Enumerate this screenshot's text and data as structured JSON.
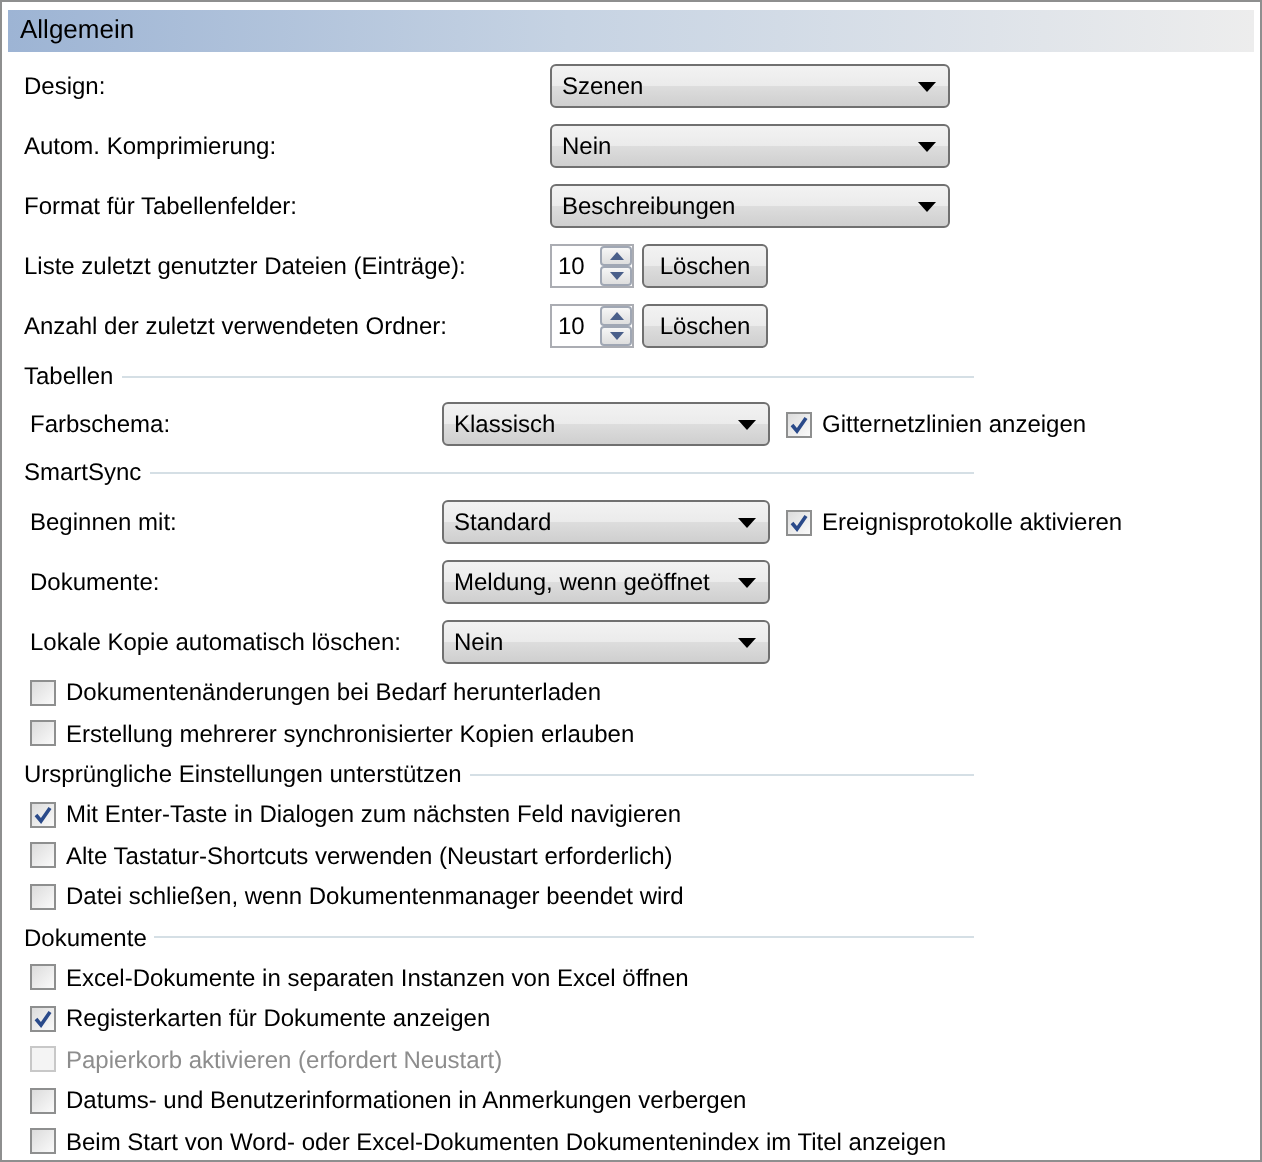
{
  "header": {
    "title": "Allgemein"
  },
  "general": [
    {
      "kind": "dropdown",
      "label": "Design:",
      "value": "Szenen"
    },
    {
      "kind": "dropdown",
      "label": "Autom. Komprimierung:",
      "value": "Nein"
    },
    {
      "kind": "dropdown",
      "label": "Format für Tabellenfelder:",
      "value": "Beschreibungen"
    },
    {
      "kind": "spinner",
      "label": "Liste zuletzt genutzter Dateien (Einträge):",
      "value": "10",
      "button": "Löschen"
    },
    {
      "kind": "spinner",
      "label": "Anzahl der zuletzt verwendeten Ordner:",
      "value": "10",
      "button": "Löschen"
    }
  ],
  "sections": [
    {
      "title": "Tabellen",
      "rows": [
        {
          "kind": "dropdown",
          "label": "Farbschema:",
          "value": "Klassisch",
          "checkbox": {
            "label": "Gitternetzlinien anzeigen",
            "checked": true
          }
        }
      ]
    },
    {
      "title": "SmartSync",
      "rows": [
        {
          "kind": "dropdown",
          "label": "Beginnen mit:",
          "value": "Standard",
          "checkbox": {
            "label": "Ereignisprotokolle aktivieren",
            "checked": true
          }
        },
        {
          "kind": "dropdown",
          "label": "Dokumente:",
          "value": "Meldung, wenn geöffnet"
        },
        {
          "kind": "dropdown",
          "label": "Lokale Kopie automatisch löschen:",
          "value": "Nein"
        },
        {
          "kind": "checkbox",
          "label": "Dokumentenänderungen bei Bedarf herunterladen",
          "checked": false,
          "disabled": false
        },
        {
          "kind": "checkbox",
          "label": "Erstellung mehrerer synchronisierter Kopien erlauben",
          "checked": false,
          "disabled": false
        }
      ]
    },
    {
      "title": "Ursprüngliche Einstellungen unterstützen",
      "rows": [
        {
          "kind": "checkbox",
          "label": "Mit Enter-Taste in Dialogen zum nächsten Feld navigieren",
          "checked": true,
          "disabled": false
        },
        {
          "kind": "checkbox",
          "label": "Alte Tastatur-Shortcuts verwenden (Neustart erforderlich)",
          "checked": false,
          "disabled": false
        },
        {
          "kind": "checkbox",
          "label": "Datei schließen, wenn Dokumentenmanager beendet wird",
          "checked": false,
          "disabled": false
        }
      ]
    },
    {
      "title": "Dokumente",
      "rows": [
        {
          "kind": "checkbox",
          "label": "Excel-Dokumente in separaten Instanzen von Excel öffnen",
          "checked": false,
          "disabled": false
        },
        {
          "kind": "checkbox",
          "label": "Registerkarten für Dokumente anzeigen",
          "checked": true,
          "disabled": false
        },
        {
          "kind": "checkbox",
          "label": "Papierkorb aktivieren (erfordert Neustart)",
          "checked": false,
          "disabled": true
        },
        {
          "kind": "checkbox",
          "label": "Datums- und Benutzerinformationen in Anmerkungen verbergen",
          "checked": false,
          "disabled": false
        },
        {
          "kind": "checkbox",
          "label": "Beim Start von Word- oder Excel-Dokumenten Dokumentenindex im Titel anzeigen",
          "checked": false,
          "disabled": false
        }
      ]
    }
  ]
}
